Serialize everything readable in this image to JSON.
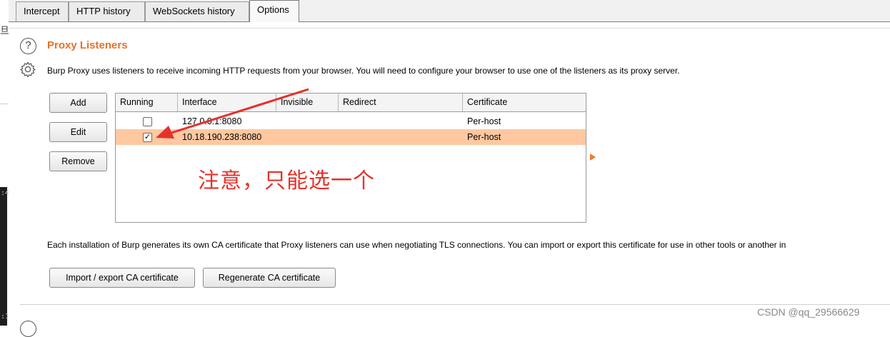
{
  "tabs": [
    {
      "label": "Intercept"
    },
    {
      "label": "HTTP history"
    },
    {
      "label": "WebSockets history"
    },
    {
      "label": "Options",
      "active": true
    }
  ],
  "section": {
    "title": "Proxy Listeners",
    "description": "Burp Proxy uses listeners to receive incoming HTTP requests from your browser. You will need to configure your browser to use one of the listeners as its proxy server.",
    "help_icon": "question-circle-icon",
    "settings_icon": "gear-icon"
  },
  "buttons": {
    "add": "Add",
    "edit": "Edit",
    "remove": "Remove",
    "import_export": "Import / export CA certificate",
    "regenerate": "Regenerate CA certificate"
  },
  "table": {
    "columns": [
      "Running",
      "Interface",
      "Invisible",
      "Redirect",
      "Certificate"
    ],
    "rows": [
      {
        "running": false,
        "interface": "127.0.0.1:8080",
        "invisible": "",
        "redirect": "",
        "certificate": "Per-host",
        "selected": false
      },
      {
        "running": true,
        "interface": "10.18.190.238:8080",
        "invisible": "",
        "redirect": "",
        "certificate": "Per-host",
        "selected": true
      }
    ]
  },
  "annotation": {
    "text": "注意，只能选一个",
    "color": "#e4322b"
  },
  "ca_description": "Each installation of Burp generates its own CA certificate that Proxy listeners can use when negotiating TLS connections. You can import or export this certificate for use in other tools or another in",
  "watermark": "CSDN @qq_29566629",
  "colors": {
    "accent": "#e8702a",
    "selected_row": "#ffc8a0"
  }
}
